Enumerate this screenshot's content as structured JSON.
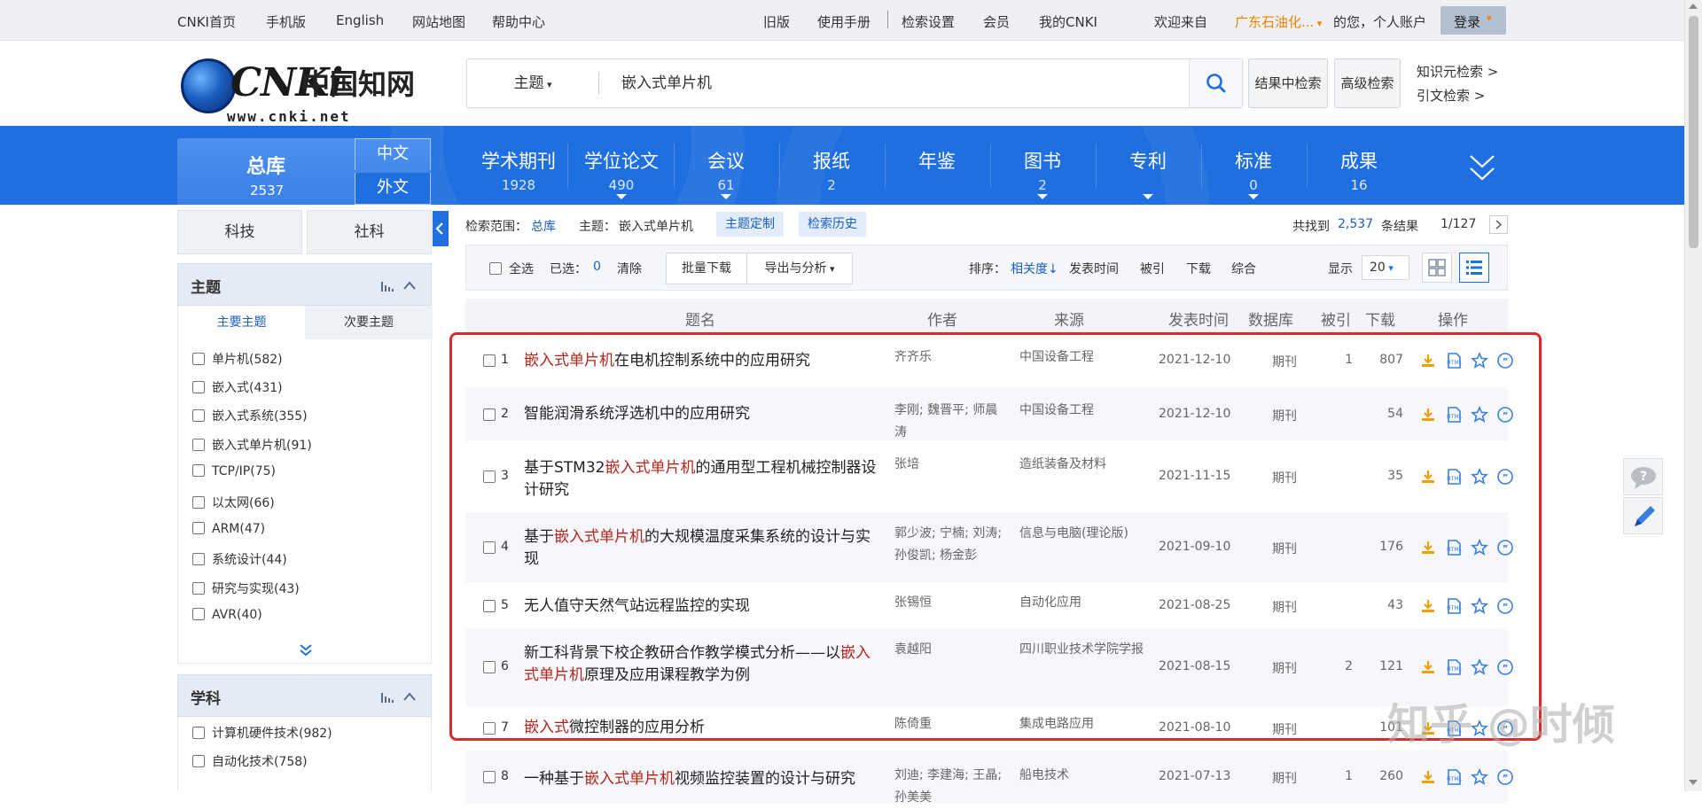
{
  "topbar": {
    "left_links": [
      "CNKI首页",
      "手机版",
      "English",
      "网站地图",
      "帮助中心"
    ],
    "right_links": [
      "旧版",
      "使用手册",
      "检索设置",
      "会员",
      "我的CNKI"
    ],
    "welcome": "欢迎来自",
    "org": "广东石油化...",
    "greeting": "的您，个人账户",
    "login": "登录"
  },
  "header": {
    "logo_word": "CNKi",
    "logo_cn": "中国知网",
    "logo_url": "www.cnki.net",
    "field": "主题",
    "keyword": "嵌入式单片机",
    "btn_result_search": "结果中检索",
    "btn_advanced": "高级检索",
    "link_knowledge": "知识元检索",
    "link_citation": "引文检索"
  },
  "nav": {
    "main_label": "总库",
    "main_count": "2537",
    "lang_cn": "中文",
    "lang_foreign": "外文",
    "items": [
      {
        "label": "学术期刊",
        "count": "1928"
      },
      {
        "label": "学位论文",
        "count": "490"
      },
      {
        "label": "会议",
        "count": "61"
      },
      {
        "label": "报纸",
        "count": "2"
      },
      {
        "label": "年鉴",
        "count": ""
      },
      {
        "label": "图书",
        "count": "2"
      },
      {
        "label": "专利",
        "count": ""
      },
      {
        "label": "标准",
        "count": "0"
      },
      {
        "label": "成果",
        "count": "16"
      }
    ]
  },
  "sidebar": {
    "tab_tech": "科技",
    "tab_social": "社科",
    "topic_header": "主题",
    "subtab_main": "主要主题",
    "subtab_secondary": "次要主题",
    "topics": [
      "单片机(582)",
      "嵌入式(431)",
      "嵌入式系统(355)",
      "嵌入式单片机(91)",
      "TCP/IP(75)",
      "以太网(66)",
      "ARM(47)",
      "系统设计(44)",
      "研究与实现(43)",
      "AVR(40)"
    ],
    "subject_header": "学科",
    "subjects": [
      "计算机硬件技术(982)",
      "自动化技术(758)"
    ]
  },
  "results_header": {
    "scope_label": "检索范围：",
    "scope_value": "总库",
    "topic_label": "主题：",
    "topic_value": "嵌入式单片机",
    "btn_customize": "主题定制",
    "btn_history": "检索历史",
    "found_prefix": "共找到",
    "found_count": "2,537",
    "found_suffix": "条结果",
    "page": "1/127"
  },
  "toolbar": {
    "select_all": "全选",
    "selected_label": "已选：",
    "selected_count": "0",
    "clear": "清除",
    "batch_download": "批量下载",
    "export": "导出与分析",
    "sort_label": "排序：",
    "sort_active": "相关度",
    "sort_options": [
      "发表时间",
      "被引",
      "下载",
      "综合"
    ],
    "display_label": "显示",
    "display_value": "20"
  },
  "table": {
    "headers": {
      "title": "题名",
      "author": "作者",
      "source": "来源",
      "date": "发表时间",
      "db": "数据库",
      "cite": "被引",
      "download": "下载",
      "ops": "操作"
    },
    "rows": [
      {
        "num": "1",
        "pre": "",
        "hl": "嵌入式单片机",
        "post": "在电机控制系统中的应用研究",
        "authors": "齐齐乐",
        "source": "中国设备工程",
        "date": "2021-12-10",
        "db": "期刊",
        "cite": "1",
        "dl": "807"
      },
      {
        "num": "2",
        "pre": "智能润滑系统浮选机中的应用研究",
        "hl": "",
        "post": "",
        "authors": "李刚; 魏晋平; 师晨涛",
        "source": "中国设备工程",
        "date": "2021-12-10",
        "db": "期刊",
        "cite": "",
        "dl": "54"
      },
      {
        "num": "3",
        "pre": "基于STM32",
        "hl": "嵌入式单片机",
        "post": "的通用型工程机械控制器设计研究",
        "authors": "张培",
        "source": "造纸装备及材料",
        "date": "2021-11-15",
        "db": "期刊",
        "cite": "",
        "dl": "35"
      },
      {
        "num": "4",
        "pre": "基于",
        "hl": "嵌入式单片机",
        "post": "的大规模温度采集系统的设计与实现",
        "authors": "郭少波; 宁楠; 刘涛; 孙俊凯; 杨金彭",
        "source": "信息与电脑(理论版)",
        "date": "2021-09-10",
        "db": "期刊",
        "cite": "",
        "dl": "176"
      },
      {
        "num": "5",
        "pre": "无人值守天然气站远程监控的实现",
        "hl": "",
        "post": "",
        "authors": "张锡恒",
        "source": "自动化应用",
        "date": "2021-08-25",
        "db": "期刊",
        "cite": "",
        "dl": "43"
      },
      {
        "num": "6",
        "pre": "新工科背景下校企教研合作教学模式分析——以",
        "hl": "嵌入式单片机",
        "post": "原理及应用课程教学为例",
        "authors": "袁越阳",
        "source": "四川职业技术学院学报",
        "date": "2021-08-15",
        "db": "期刊",
        "cite": "2",
        "dl": "121"
      },
      {
        "num": "7",
        "pre": "",
        "hl": "嵌入式",
        "post": "微控制器的应用分析",
        "authors": "陈倚重",
        "source": "集成电路应用",
        "date": "2021-08-10",
        "db": "期刊",
        "cite": "",
        "dl": "101"
      },
      {
        "num": "8",
        "pre": "一种基于",
        "hl": "嵌入式单片机",
        "post": "视频监控装置的设计与研究",
        "authors": "刘迪; 李建海; 王晶; 孙美美",
        "source": "船电技术",
        "date": "2021-07-13",
        "db": "期刊",
        "cite": "1",
        "dl": "260"
      }
    ]
  },
  "watermark": "知乎 @时倾",
  "colors": {
    "brand_blue": "#1f6fe0",
    "highlight_red": "#b5241b",
    "annotation_red": "#e12828",
    "link_blue": "#1a5fc0"
  }
}
